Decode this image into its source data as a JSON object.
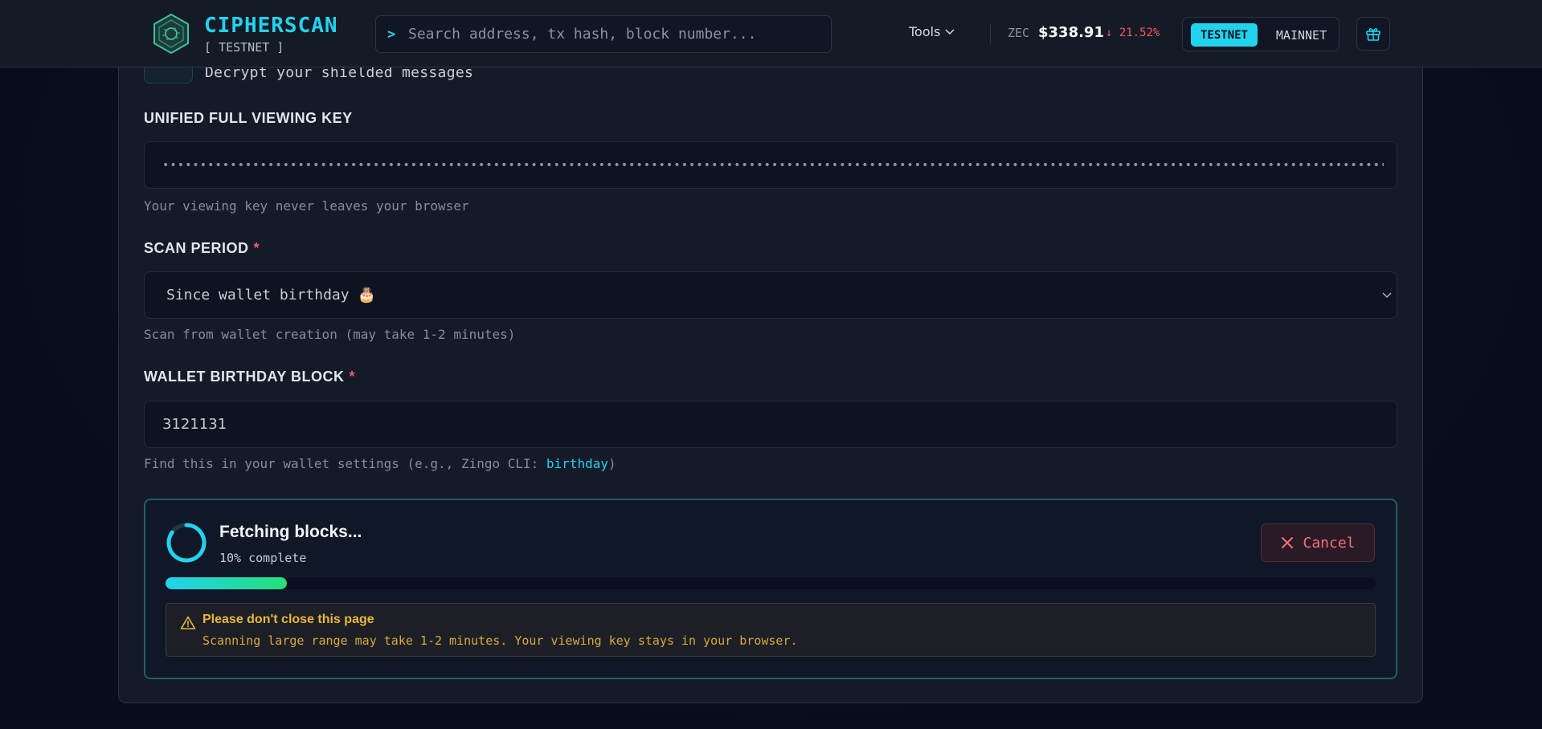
{
  "header": {
    "brand": "CIPHERSCAN",
    "network_sub": "[ TESTNET ]",
    "search": {
      "prompt": ">",
      "placeholder": "Search address, tx hash, block number..."
    },
    "tools_label": "Tools",
    "price": {
      "symbol": "ZEC",
      "value": "$338.91",
      "change": "↓ 21.52%"
    },
    "network_toggle": {
      "testnet": "TESTNET",
      "mainnet": "MAINNET",
      "active": "testnet"
    },
    "icons": {
      "logo": "hexagon-logo-icon",
      "gift": "gift-icon",
      "tools_chevron": "chevron-down-icon"
    }
  },
  "form": {
    "intro_text": "Decrypt your shielded messages",
    "ufvk": {
      "label": "UNIFIED FULL VIEWING KEY",
      "masked_value": "•••••••••••••••••••••••••••••••••••••••••••••••••••••••••••••••••••••••••••••••••••••••••••••••••••••••••••••••••••••••••••••••••••••••••••••••••••••••••••••••••••",
      "hint": "Your viewing key never leaves your browser"
    },
    "scan_period": {
      "label": "SCAN PERIOD",
      "required_mark": "*",
      "selected": "Since wallet birthday 🎂",
      "hint": "Scan from wallet creation (may take 1-2 minutes)"
    },
    "birthday_block": {
      "label": "WALLET BIRTHDAY BLOCK",
      "required_mark": "*",
      "value": "3121131",
      "hint_prefix": "Find this in your wallet settings (e.g., Zingo CLI: ",
      "hint_code": "birthday",
      "hint_suffix": ")"
    }
  },
  "progress": {
    "title": "Fetching blocks...",
    "percent_text": "10% complete",
    "percent": 10,
    "cancel_label": "Cancel",
    "warning": {
      "title": "Please don't close this page",
      "text": "Scanning large range may take 1-2 minutes. Your viewing key stays in your browser."
    }
  },
  "colors": {
    "accent": "#22d3ee",
    "progress_end": "#22e07a",
    "danger": "#f0717a",
    "warning": "#e8b93a"
  }
}
